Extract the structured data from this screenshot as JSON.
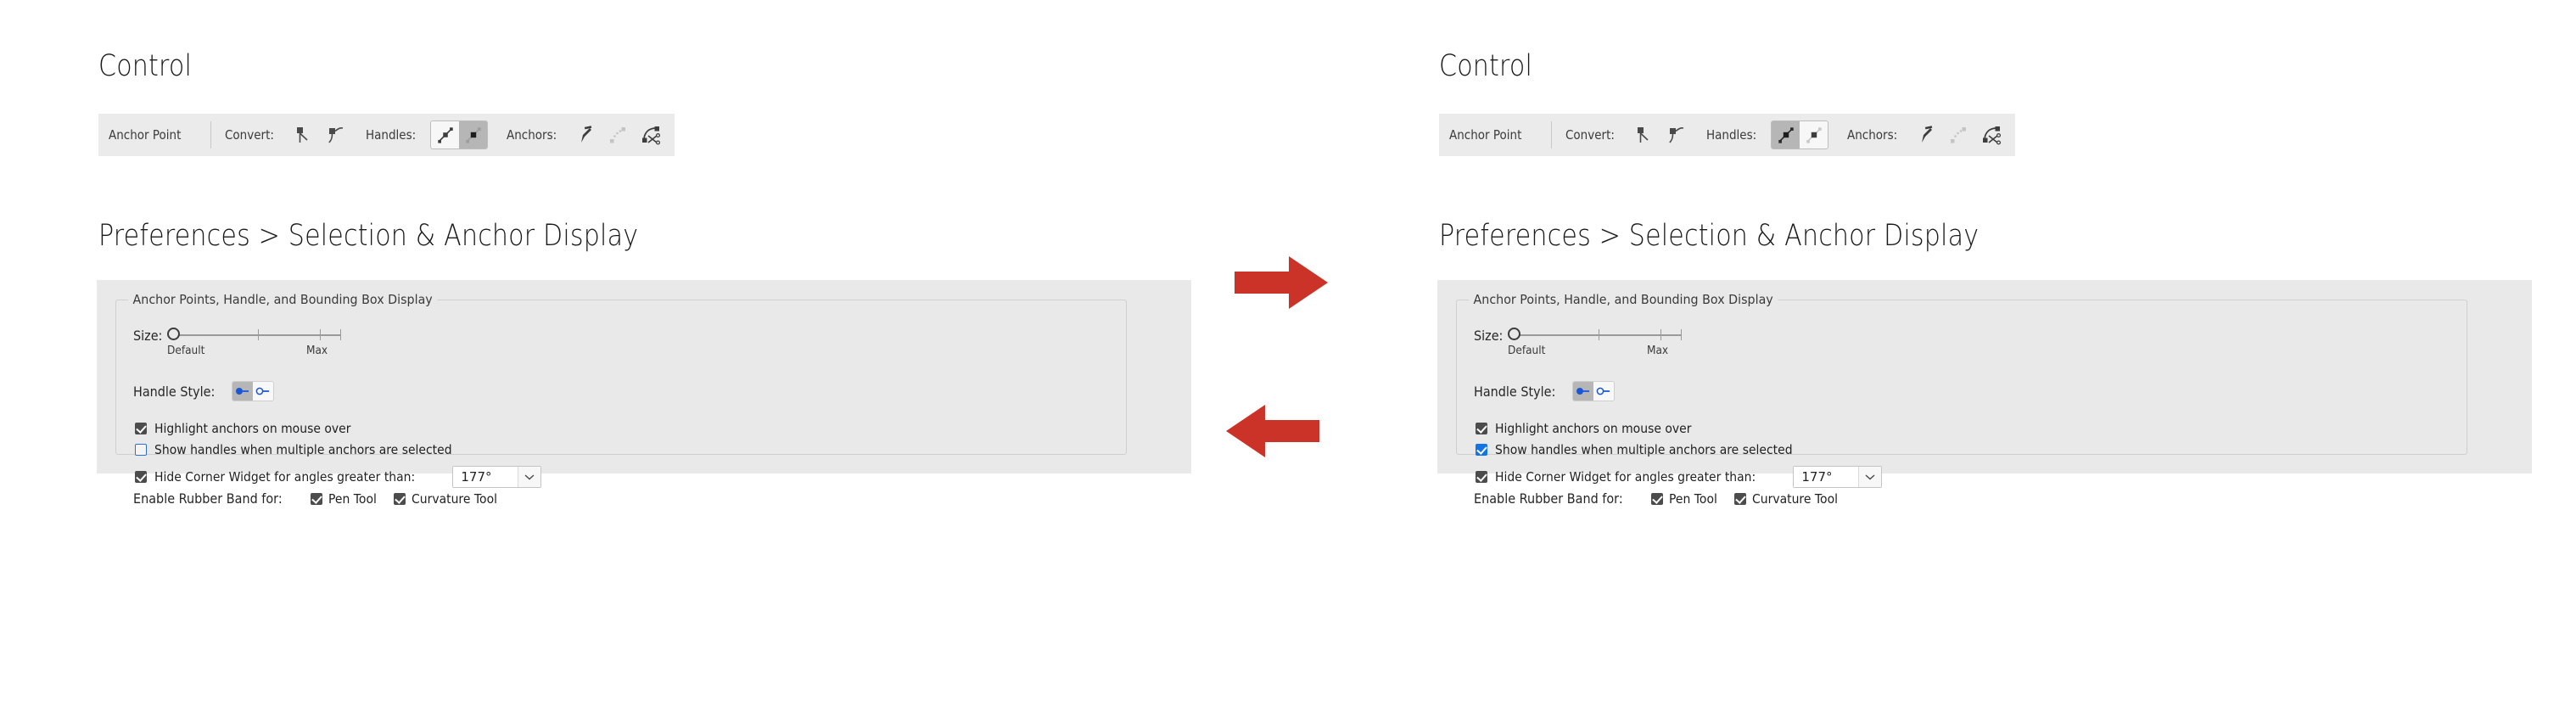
{
  "page": {
    "accent_red": "#cc3328",
    "toolbar_bg": "#ebebeb",
    "panel_bg": "#e9e9e9",
    "blue": "#1473e6"
  },
  "panels": [
    {
      "id": "before",
      "heading_control": "Control",
      "heading_prefs": "Preferences > Selection & Anchor Display",
      "control_bar": {
        "title": "Anchor Point",
        "convert_label": "Convert:",
        "convert_icons": [
          "convert-to-corner-icon",
          "convert-to-smooth-icon"
        ],
        "handles_label": "Handles:",
        "handles_buttons": [
          {
            "icon": "show-handles-icon",
            "selected": false
          },
          {
            "icon": "hide-handles-icon",
            "selected": true
          }
        ],
        "anchors_label": "Anchors:",
        "anchors_icons": [
          {
            "icon": "add-anchor-pen-icon",
            "enabled": true
          },
          {
            "icon": "remove-anchor-icon",
            "enabled": false
          },
          {
            "icon": "cut-path-scissors-icon",
            "enabled": true
          }
        ]
      },
      "prefs": {
        "group_title": "Anchor Points, Handle, and Bounding Box Display",
        "size_label": "Size:",
        "size_min_caption": "Default",
        "size_max_caption": "Max",
        "size_value_percent": 0,
        "handle_style_label": "Handle Style:",
        "handle_styles": [
          {
            "icon": "filled-handle-icon",
            "selected": true
          },
          {
            "icon": "hollow-handle-icon",
            "selected": false
          }
        ],
        "checkboxes": [
          {
            "label": "Highlight anchors on mouse over",
            "state": "checked"
          },
          {
            "label": "Show handles when multiple anchors are selected",
            "state": "unchecked"
          },
          {
            "label": "Hide Corner Widget for angles greater than:",
            "state": "checked"
          }
        ],
        "angle_value": "177°",
        "rubber_band_label": "Enable Rubber Band for:",
        "rubber_band_options": [
          {
            "label": "Pen Tool",
            "state": "checked"
          },
          {
            "label": "Curvature Tool",
            "state": "checked"
          }
        ]
      }
    },
    {
      "id": "after",
      "heading_control": "Control",
      "heading_prefs": "Preferences > Selection & Anchor Display",
      "control_bar": {
        "title": "Anchor Point",
        "convert_label": "Convert:",
        "convert_icons": [
          "convert-to-corner-icon",
          "convert-to-smooth-icon"
        ],
        "handles_label": "Handles:",
        "handles_buttons": [
          {
            "icon": "show-handles-icon",
            "selected": true
          },
          {
            "icon": "hide-handles-icon",
            "selected": false
          }
        ],
        "anchors_label": "Anchors:",
        "anchors_icons": [
          {
            "icon": "add-anchor-pen-icon",
            "enabled": true
          },
          {
            "icon": "remove-anchor-icon",
            "enabled": false
          },
          {
            "icon": "cut-path-scissors-icon",
            "enabled": true
          }
        ]
      },
      "prefs": {
        "group_title": "Anchor Points, Handle, and Bounding Box Display",
        "size_label": "Size:",
        "size_min_caption": "Default",
        "size_max_caption": "Max",
        "size_value_percent": 0,
        "handle_style_label": "Handle Style:",
        "handle_styles": [
          {
            "icon": "filled-handle-icon",
            "selected": true
          },
          {
            "icon": "hollow-handle-icon",
            "selected": false
          }
        ],
        "checkboxes": [
          {
            "label": "Highlight anchors on mouse over",
            "state": "checked"
          },
          {
            "label": "Show handles when multiple anchors are selected",
            "state": "checked-blue"
          },
          {
            "label": "Hide Corner Widget for angles greater than:",
            "state": "checked"
          }
        ],
        "angle_value": "177°",
        "rubber_band_label": "Enable Rubber Band for:",
        "rubber_band_options": [
          {
            "label": "Pen Tool",
            "state": "checked"
          },
          {
            "label": "Curvature Tool",
            "state": "checked"
          }
        ]
      }
    }
  ],
  "annotations": {
    "arrow_right": "arrow-right-icon",
    "arrow_left": "arrow-left-icon"
  }
}
